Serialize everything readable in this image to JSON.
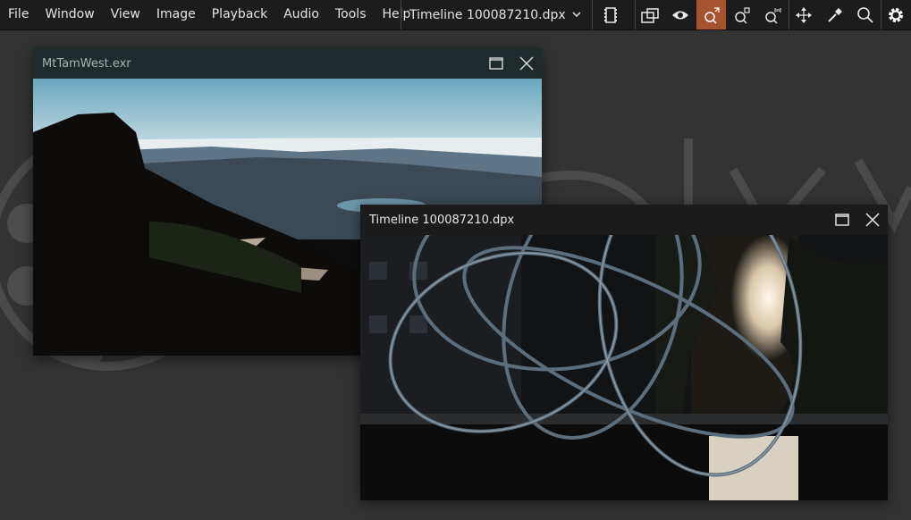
{
  "menubar": {
    "items": [
      "File",
      "Window",
      "View",
      "Image",
      "Playback",
      "Audio",
      "Tools",
      "Help"
    ],
    "timeline_selector": "Timeline 100087210.dpx"
  },
  "toolbar": {
    "tools": [
      "media-strip-icon",
      "compare-icon",
      "eye-icon",
      "zoom-fit-icon",
      "zoom-box-icon",
      "zoom-1to1-icon",
      "pan-icon",
      "color-picker-icon",
      "magnifier-icon",
      "settings-gear-icon"
    ],
    "active_tool": "zoom-fit-icon",
    "accent_color": "#a5522f"
  },
  "windows": [
    {
      "title": "MtTamWest.exr",
      "image": "mountain landscape"
    },
    {
      "title": "Timeline 100087210.dpx",
      "image": "metal loop sculpture"
    }
  ]
}
